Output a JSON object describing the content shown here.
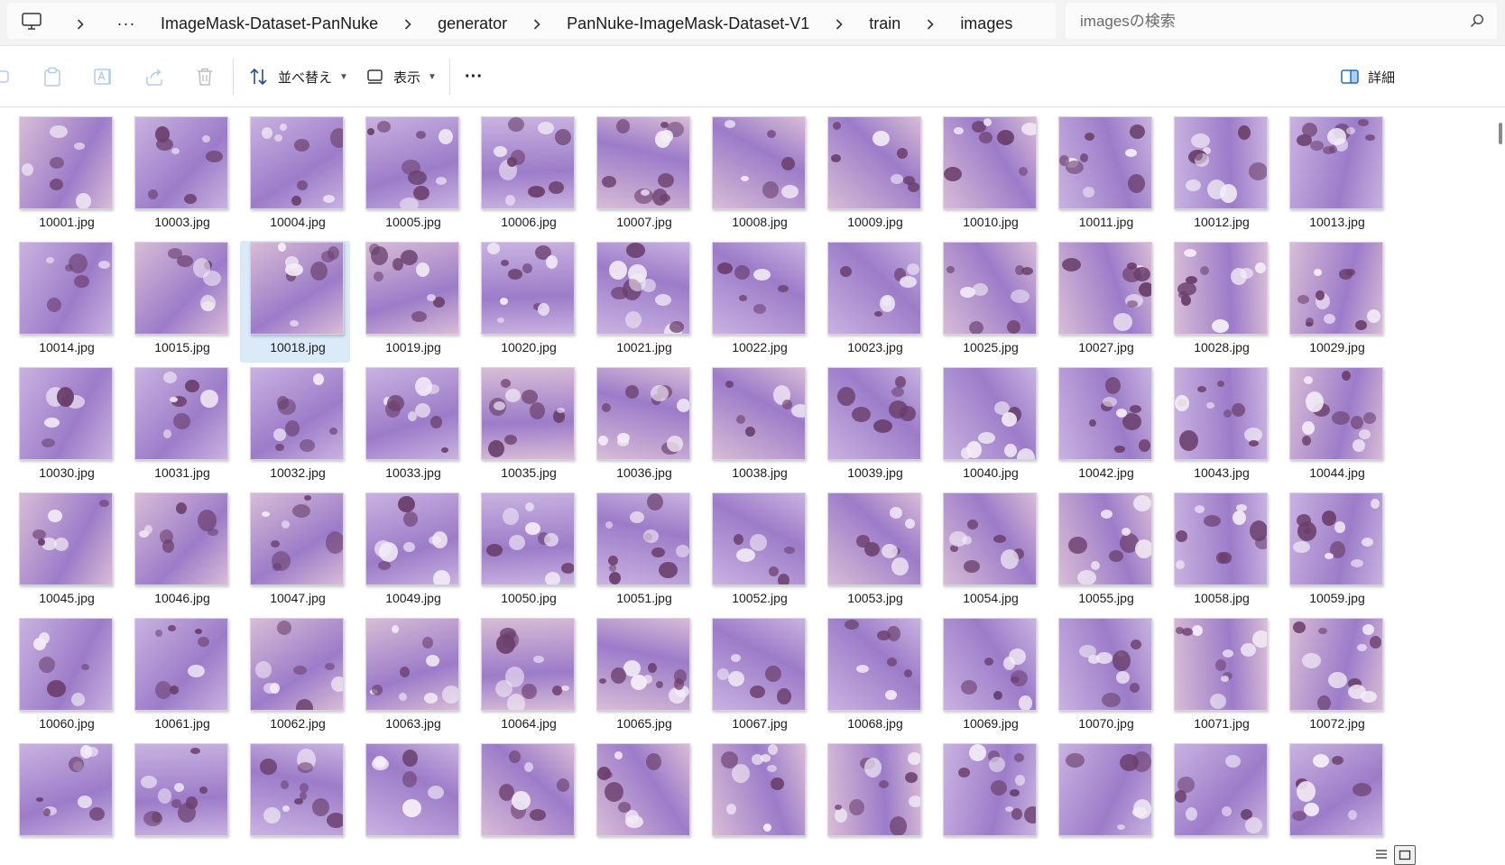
{
  "address_bar": {
    "more_label": "···",
    "breadcrumbs": [
      "ImageMask-Dataset-PanNuke",
      "generator",
      "PanNuke-ImageMask-Dataset-V1",
      "train",
      "images"
    ]
  },
  "search": {
    "placeholder": "imagesの検索"
  },
  "toolbar": {
    "sort_label": "並べ替え",
    "view_label": "表示",
    "more_label": "···",
    "details_label": "詳細"
  },
  "files": [
    "10001.jpg",
    "10003.jpg",
    "10004.jpg",
    "10005.jpg",
    "10006.jpg",
    "10007.jpg",
    "10008.jpg",
    "10009.jpg",
    "10010.jpg",
    "10011.jpg",
    "10012.jpg",
    "10013.jpg",
    "10014.jpg",
    "10015.jpg",
    "10018.jpg",
    "10019.jpg",
    "10020.jpg",
    "10021.jpg",
    "10022.jpg",
    "10023.jpg",
    "10025.jpg",
    "10027.jpg",
    "10028.jpg",
    "10029.jpg",
    "10030.jpg",
    "10031.jpg",
    "10032.jpg",
    "10033.jpg",
    "10035.jpg",
    "10036.jpg",
    "10038.jpg",
    "10039.jpg",
    "10040.jpg",
    "10042.jpg",
    "10043.jpg",
    "10044.jpg",
    "10045.jpg",
    "10046.jpg",
    "10047.jpg",
    "10049.jpg",
    "10050.jpg",
    "10051.jpg",
    "10052.jpg",
    "10053.jpg",
    "10054.jpg",
    "10055.jpg",
    "10058.jpg",
    "10059.jpg",
    "10060.jpg",
    "10061.jpg",
    "10062.jpg",
    "10063.jpg",
    "10064.jpg",
    "10065.jpg",
    "10067.jpg",
    "10068.jpg",
    "10069.jpg",
    "10070.jpg",
    "10071.jpg",
    "10072.jpg"
  ],
  "partial_row_count": 12,
  "selected_file": "10018.jpg",
  "colors": {
    "stain_light": "#c9b2e0",
    "stain_mid": "#9c7cc9",
    "stain_pink": "#d8bcd6",
    "nucleus": "#6a3f6b",
    "selection": "#dbeaf8"
  }
}
